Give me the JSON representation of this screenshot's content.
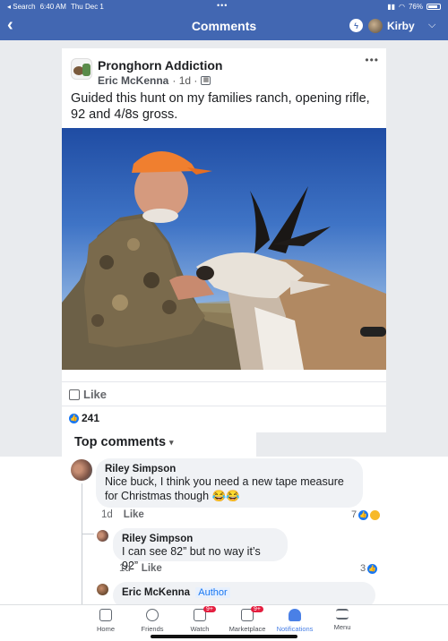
{
  "status_bar": {
    "back_app": "◂ Search",
    "time": "6:40 AM",
    "date": "Thu Dec 1",
    "battery": "76%"
  },
  "nav": {
    "title": "Comments",
    "user": "Kirby"
  },
  "post": {
    "group": "Pronghorn Addiction",
    "author": "Eric McKenna",
    "age": "· 1d ·",
    "text": "Guided this hunt on my families ranch, opening rifle, 92 and 4/8s gross.",
    "like_label": "Like",
    "reaction_count": "241",
    "top_comments": "Top comments"
  },
  "comments": [
    {
      "name": "Riley Simpson",
      "body": "Nice buck, I think you need a new tape measure for Christmas though 😂😂",
      "age": "1d",
      "like": "Like",
      "reacts": "7"
    },
    {
      "name": "Riley Simpson",
      "body": "I can see 82” but no way it’s 92”",
      "age": "1d",
      "like": "Like",
      "reacts": "3"
    },
    {
      "name": "Eric McKenna",
      "badge": "Author"
    }
  ],
  "tabs": [
    {
      "label": "Home"
    },
    {
      "label": "Friends"
    },
    {
      "label": "Watch",
      "badge": "9+"
    },
    {
      "label": "Marketplace",
      "badge": "9+"
    },
    {
      "label": "Notifications"
    },
    {
      "label": "Menu"
    }
  ],
  "colors": {
    "brand": "#4267b2",
    "accent": "#1877f2",
    "badge": "#e41e3f"
  }
}
